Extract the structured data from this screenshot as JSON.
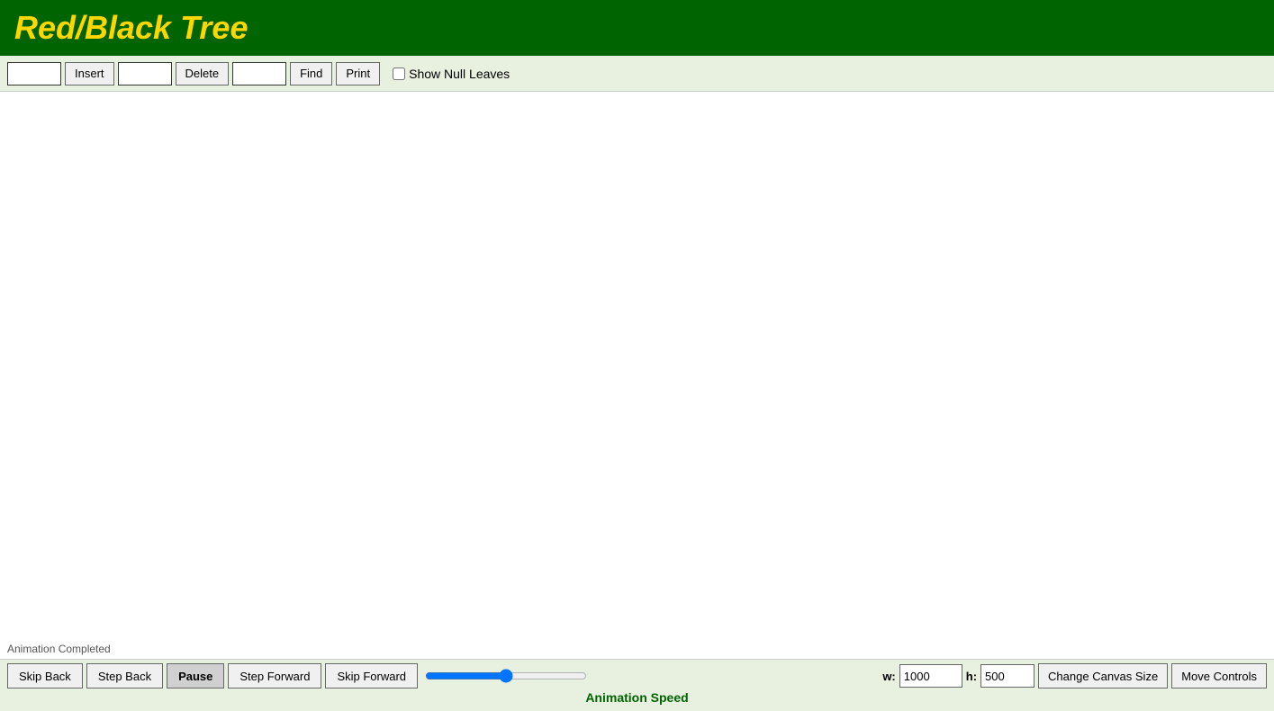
{
  "header": {
    "title": "Red/Black Tree"
  },
  "toolbar": {
    "insert_placeholder": "",
    "insert_label": "Insert",
    "delete_placeholder": "",
    "delete_label": "Delete",
    "find_placeholder": "",
    "find_label": "Find",
    "print_label": "Print",
    "show_null_leaves_label": "Show Null Leaves",
    "show_null_leaves_checked": false
  },
  "canvas": {
    "status_text": "Animation Completed"
  },
  "bottom_bar": {
    "skip_back_label": "Skip Back",
    "step_back_label": "Step Back",
    "pause_label": "Pause",
    "step_forward_label": "Step Forward",
    "skip_forward_label": "Skip Forward",
    "animation_speed_label": "Animation Speed",
    "canvas_width_label": "w:",
    "canvas_width_value": "1000",
    "canvas_height_label": "h:",
    "canvas_height_value": "500",
    "change_canvas_size_label": "Change Canvas Size",
    "move_controls_label": "Move Controls"
  }
}
